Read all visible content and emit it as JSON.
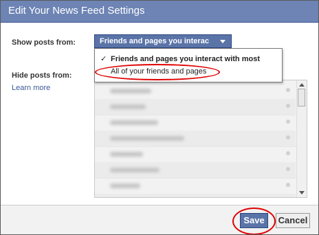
{
  "dialog": {
    "title": "Edit Your News Feed Settings"
  },
  "show_posts": {
    "label": "Show posts from:",
    "selected": "Friends and pages you interac",
    "options": [
      {
        "label": "Friends and pages you interact with most",
        "checked": true
      },
      {
        "label": "All of your friends and pages",
        "checked": false
      }
    ],
    "check_glyph": "✓"
  },
  "hide_posts": {
    "label": "Hide posts from:",
    "learn_more": "Learn more",
    "row_count": 8
  },
  "footer": {
    "save": "Save",
    "cancel": "Cancel"
  },
  "colors": {
    "titlebar": "#6d84b4",
    "button": "#5b74a8",
    "highlight": "#e00000"
  }
}
